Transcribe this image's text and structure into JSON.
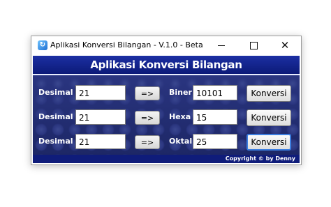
{
  "window": {
    "title": "Aplikasi Konversi Bilangan - V.1.0 - Beta",
    "icon": "app-icon",
    "controls": {
      "minimize": "minimize-icon",
      "maximize": "maximize-icon",
      "close": "close-icon"
    }
  },
  "header": {
    "title": "Aplikasi Konversi Bilangan"
  },
  "rows": [
    {
      "source_label": "Desimal",
      "source_value": "21",
      "arrow_label": "=>",
      "target_label": "Biner",
      "target_value": "10101",
      "button_label": "Konversi"
    },
    {
      "source_label": "Desimal",
      "source_value": "21",
      "arrow_label": "=>",
      "target_label": "Hexa",
      "target_value": "15",
      "button_label": "Konversi"
    },
    {
      "source_label": "Desimal",
      "source_value": "21",
      "arrow_label": "=>",
      "target_label": "Oktal",
      "target_value": "25",
      "button_label": "Konversi"
    }
  ],
  "footer": {
    "copyright": "Copyright ©  by Denny"
  },
  "colors": {
    "header_bg": "#0c1a78",
    "panel_bg": "#232e72",
    "footer_bg": "#0f1c7a",
    "focus_border": "#3c7ee0"
  }
}
